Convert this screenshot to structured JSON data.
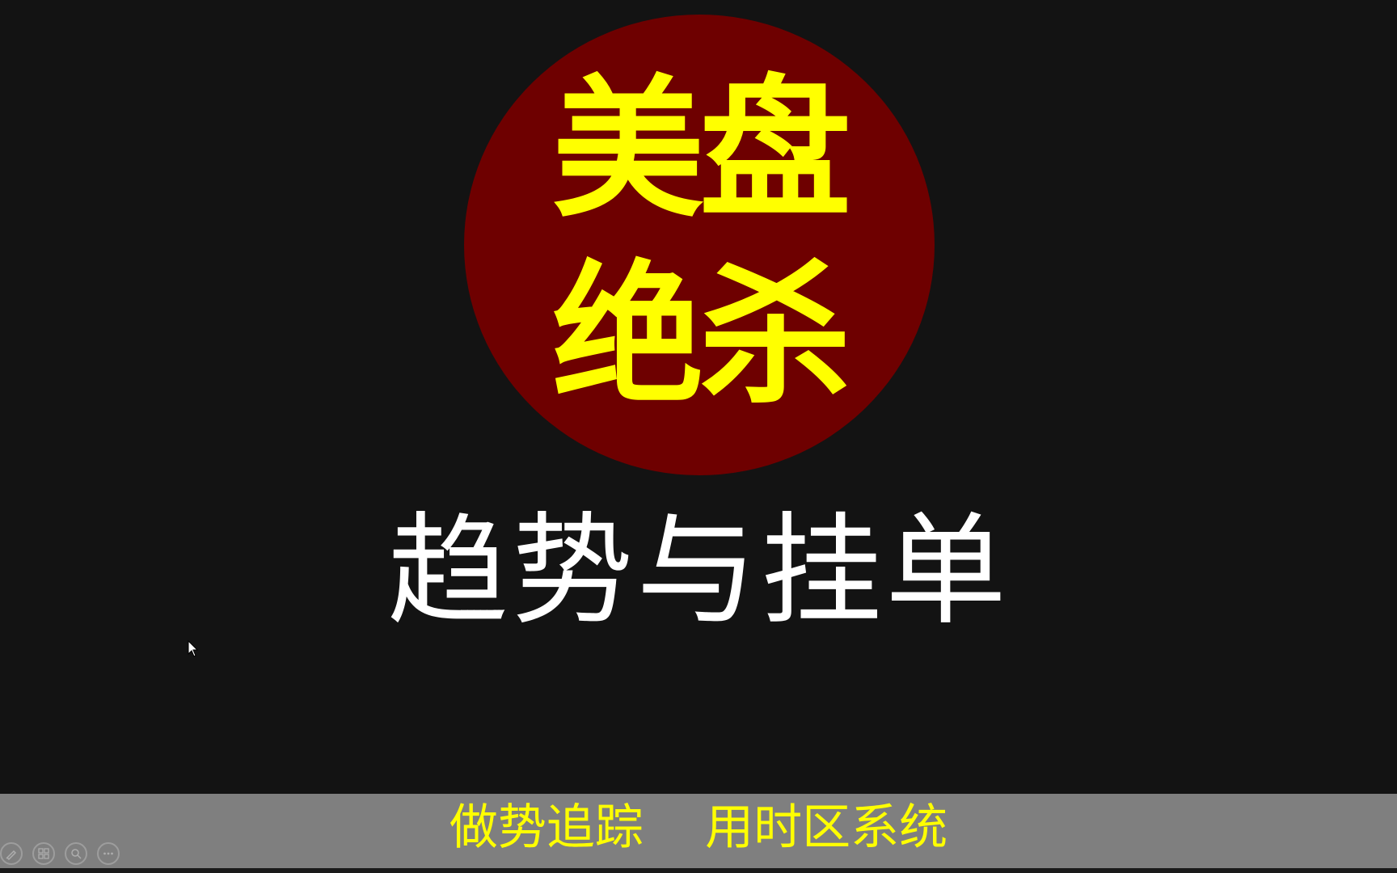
{
  "slide": {
    "title_line1": "美盘",
    "title_line2": "绝杀",
    "subtitle": "趋势与挂单",
    "banner": "做势追踪    用时区系统"
  },
  "toolbar": {
    "buttons": [
      {
        "icon": "pen-icon"
      },
      {
        "icon": "slides-icon"
      },
      {
        "icon": "zoom-icon"
      },
      {
        "icon": "more-icon"
      }
    ]
  },
  "colors": {
    "background": "#131313",
    "circle": "#6e0000",
    "title": "#ffff00",
    "subtitle": "#ffffff",
    "banner_bg": "#7f7f7f",
    "banner_text": "#ffff00"
  }
}
